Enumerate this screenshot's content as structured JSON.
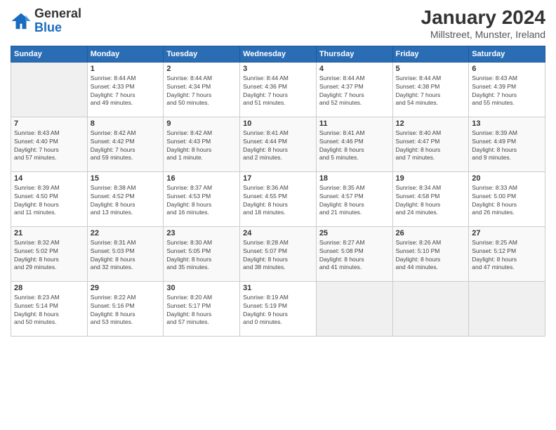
{
  "logo": {
    "general": "General",
    "blue": "Blue"
  },
  "title": "January 2024",
  "subtitle": "Millstreet, Munster, Ireland",
  "days_header": [
    "Sunday",
    "Monday",
    "Tuesday",
    "Wednesday",
    "Thursday",
    "Friday",
    "Saturday"
  ],
  "weeks": [
    [
      {
        "num": "",
        "detail": ""
      },
      {
        "num": "1",
        "detail": "Sunrise: 8:44 AM\nSunset: 4:33 PM\nDaylight: 7 hours\nand 49 minutes."
      },
      {
        "num": "2",
        "detail": "Sunrise: 8:44 AM\nSunset: 4:34 PM\nDaylight: 7 hours\nand 50 minutes."
      },
      {
        "num": "3",
        "detail": "Sunrise: 8:44 AM\nSunset: 4:36 PM\nDaylight: 7 hours\nand 51 minutes."
      },
      {
        "num": "4",
        "detail": "Sunrise: 8:44 AM\nSunset: 4:37 PM\nDaylight: 7 hours\nand 52 minutes."
      },
      {
        "num": "5",
        "detail": "Sunrise: 8:44 AM\nSunset: 4:38 PM\nDaylight: 7 hours\nand 54 minutes."
      },
      {
        "num": "6",
        "detail": "Sunrise: 8:43 AM\nSunset: 4:39 PM\nDaylight: 7 hours\nand 55 minutes."
      }
    ],
    [
      {
        "num": "7",
        "detail": "Sunrise: 8:43 AM\nSunset: 4:40 PM\nDaylight: 7 hours\nand 57 minutes."
      },
      {
        "num": "8",
        "detail": "Sunrise: 8:42 AM\nSunset: 4:42 PM\nDaylight: 7 hours\nand 59 minutes."
      },
      {
        "num": "9",
        "detail": "Sunrise: 8:42 AM\nSunset: 4:43 PM\nDaylight: 8 hours\nand 1 minute."
      },
      {
        "num": "10",
        "detail": "Sunrise: 8:41 AM\nSunset: 4:44 PM\nDaylight: 8 hours\nand 2 minutes."
      },
      {
        "num": "11",
        "detail": "Sunrise: 8:41 AM\nSunset: 4:46 PM\nDaylight: 8 hours\nand 5 minutes."
      },
      {
        "num": "12",
        "detail": "Sunrise: 8:40 AM\nSunset: 4:47 PM\nDaylight: 8 hours\nand 7 minutes."
      },
      {
        "num": "13",
        "detail": "Sunrise: 8:39 AM\nSunset: 4:49 PM\nDaylight: 8 hours\nand 9 minutes."
      }
    ],
    [
      {
        "num": "14",
        "detail": "Sunrise: 8:39 AM\nSunset: 4:50 PM\nDaylight: 8 hours\nand 11 minutes."
      },
      {
        "num": "15",
        "detail": "Sunrise: 8:38 AM\nSunset: 4:52 PM\nDaylight: 8 hours\nand 13 minutes."
      },
      {
        "num": "16",
        "detail": "Sunrise: 8:37 AM\nSunset: 4:53 PM\nDaylight: 8 hours\nand 16 minutes."
      },
      {
        "num": "17",
        "detail": "Sunrise: 8:36 AM\nSunset: 4:55 PM\nDaylight: 8 hours\nand 18 minutes."
      },
      {
        "num": "18",
        "detail": "Sunrise: 8:35 AM\nSunset: 4:57 PM\nDaylight: 8 hours\nand 21 minutes."
      },
      {
        "num": "19",
        "detail": "Sunrise: 8:34 AM\nSunset: 4:58 PM\nDaylight: 8 hours\nand 24 minutes."
      },
      {
        "num": "20",
        "detail": "Sunrise: 8:33 AM\nSunset: 5:00 PM\nDaylight: 8 hours\nand 26 minutes."
      }
    ],
    [
      {
        "num": "21",
        "detail": "Sunrise: 8:32 AM\nSunset: 5:02 PM\nDaylight: 8 hours\nand 29 minutes."
      },
      {
        "num": "22",
        "detail": "Sunrise: 8:31 AM\nSunset: 5:03 PM\nDaylight: 8 hours\nand 32 minutes."
      },
      {
        "num": "23",
        "detail": "Sunrise: 8:30 AM\nSunset: 5:05 PM\nDaylight: 8 hours\nand 35 minutes."
      },
      {
        "num": "24",
        "detail": "Sunrise: 8:28 AM\nSunset: 5:07 PM\nDaylight: 8 hours\nand 38 minutes."
      },
      {
        "num": "25",
        "detail": "Sunrise: 8:27 AM\nSunset: 5:08 PM\nDaylight: 8 hours\nand 41 minutes."
      },
      {
        "num": "26",
        "detail": "Sunrise: 8:26 AM\nSunset: 5:10 PM\nDaylight: 8 hours\nand 44 minutes."
      },
      {
        "num": "27",
        "detail": "Sunrise: 8:25 AM\nSunset: 5:12 PM\nDaylight: 8 hours\nand 47 minutes."
      }
    ],
    [
      {
        "num": "28",
        "detail": "Sunrise: 8:23 AM\nSunset: 5:14 PM\nDaylight: 8 hours\nand 50 minutes."
      },
      {
        "num": "29",
        "detail": "Sunrise: 8:22 AM\nSunset: 5:16 PM\nDaylight: 8 hours\nand 53 minutes."
      },
      {
        "num": "30",
        "detail": "Sunrise: 8:20 AM\nSunset: 5:17 PM\nDaylight: 8 hours\nand 57 minutes."
      },
      {
        "num": "31",
        "detail": "Sunrise: 8:19 AM\nSunset: 5:19 PM\nDaylight: 9 hours\nand 0 minutes."
      },
      {
        "num": "",
        "detail": ""
      },
      {
        "num": "",
        "detail": ""
      },
      {
        "num": "",
        "detail": ""
      }
    ]
  ]
}
